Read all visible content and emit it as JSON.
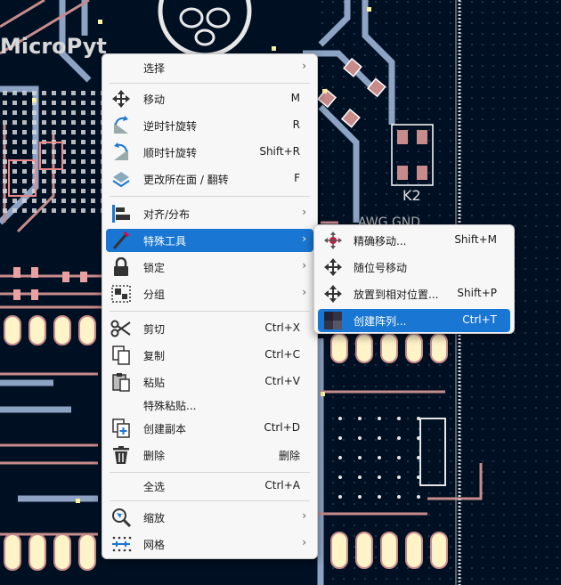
{
  "board": {
    "labels": {
      "k2": "K2",
      "awg_gnd": "AWG GND",
      "silk": "MicroPyt"
    }
  },
  "context_menu": {
    "items": [
      {
        "label": "选择",
        "shortcut": "",
        "submenu": true,
        "icon": "none"
      },
      {
        "label": "移动",
        "shortcut": "M",
        "submenu": false,
        "icon": "move-icon"
      },
      {
        "label": "逆时针旋转",
        "shortcut": "R",
        "submenu": false,
        "icon": "rotate-ccw-icon"
      },
      {
        "label": "顺时针旋转",
        "shortcut": "Shift+R",
        "submenu": false,
        "icon": "rotate-cw-icon"
      },
      {
        "label": "更改所在面 / 翻转",
        "shortcut": "F",
        "submenu": false,
        "icon": "flip-icon"
      },
      {
        "label": "对齐/分布",
        "shortcut": "",
        "submenu": true,
        "icon": "align-icon"
      },
      {
        "label": "特殊工具",
        "shortcut": "",
        "submenu": true,
        "icon": "special-tools-icon",
        "highlighted": true
      },
      {
        "label": "锁定",
        "shortcut": "",
        "submenu": true,
        "icon": "lock-icon"
      },
      {
        "label": "分组",
        "shortcut": "",
        "submenu": true,
        "icon": "group-icon"
      },
      {
        "label": "剪切",
        "shortcut": "Ctrl+X",
        "submenu": false,
        "icon": "cut-icon"
      },
      {
        "label": "复制",
        "shortcut": "Ctrl+C",
        "submenu": false,
        "icon": "copy-icon"
      },
      {
        "label": "粘贴",
        "shortcut": "Ctrl+V",
        "submenu": false,
        "icon": "paste-icon"
      },
      {
        "label": "特殊粘贴...",
        "shortcut": "",
        "submenu": false,
        "icon": "none"
      },
      {
        "label": "创建副本",
        "shortcut": "Ctrl+D",
        "submenu": false,
        "icon": "duplicate-icon"
      },
      {
        "label": "删除",
        "shortcut": "删除",
        "submenu": false,
        "icon": "delete-icon"
      },
      {
        "label": "全选",
        "shortcut": "Ctrl+A",
        "submenu": false,
        "icon": "none"
      },
      {
        "label": "缩放",
        "shortcut": "",
        "submenu": true,
        "icon": "zoom-icon"
      },
      {
        "label": "网格",
        "shortcut": "",
        "submenu": true,
        "icon": "grid-icon"
      }
    ]
  },
  "submenu": {
    "items": [
      {
        "label": "精确移动...",
        "shortcut": "Shift+M",
        "icon": "precise-move-icon"
      },
      {
        "label": "随位号移动",
        "shortcut": "",
        "icon": "move-with-reference-icon"
      },
      {
        "label": "放置到相对位置...",
        "shortcut": "Shift+P",
        "icon": "position-relative-icon"
      },
      {
        "label": "创建阵列...",
        "shortcut": "Ctrl+T",
        "icon": "create-array-icon",
        "highlighted": true
      }
    ]
  },
  "colors": {
    "board_bg": "#001023",
    "copper_front": "#c88b8b",
    "copper_back": "#9db4d6",
    "pad": "#fff3c8",
    "menu_bg": "#f7f7f7",
    "highlight": "#1976d2"
  }
}
